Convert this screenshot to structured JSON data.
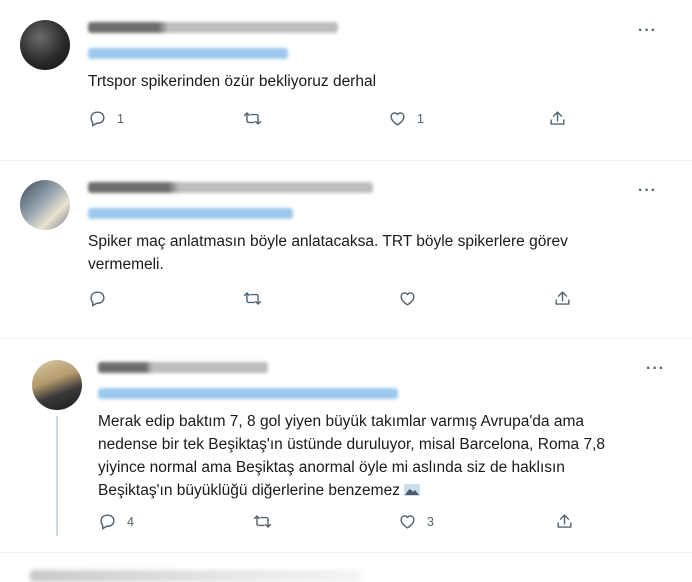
{
  "tweets": [
    {
      "text": "Trtspor spikerinden özür bekliyoruz derhal",
      "reply_count": "1",
      "retweet_count": "",
      "like_count": "1"
    },
    {
      "text": "Spiker maç anlatmasın böyle anlatacaksa. TRT böyle spikerlere görev\nvermemeli.",
      "reply_count": "",
      "retweet_count": "",
      "like_count": ""
    },
    {
      "text": "Merak edip baktım 7, 8 gol yiyen büyük takımlar varmış Avrupa'da ama\nnedense bir tek Beşiktaş'ın üstünde duruluyor, misal Barcelona, Roma 7,8\nyiyince normal ama Beşiktaş anormal öyle mi aslında siz de haklısın\nBeşiktaş'ın büyüklüğü diğerlerine benzemez",
      "reply_count": "4",
      "retweet_count": "",
      "like_count": "3"
    }
  ],
  "icons": {
    "reply": "reply-icon",
    "retweet": "retweet-icon",
    "like": "heart-icon",
    "share": "share-icon",
    "more": "more-options-icon"
  },
  "colors": {
    "icon": "#536471",
    "text": "#0f1419",
    "reply_link": "#1d9bf0"
  }
}
